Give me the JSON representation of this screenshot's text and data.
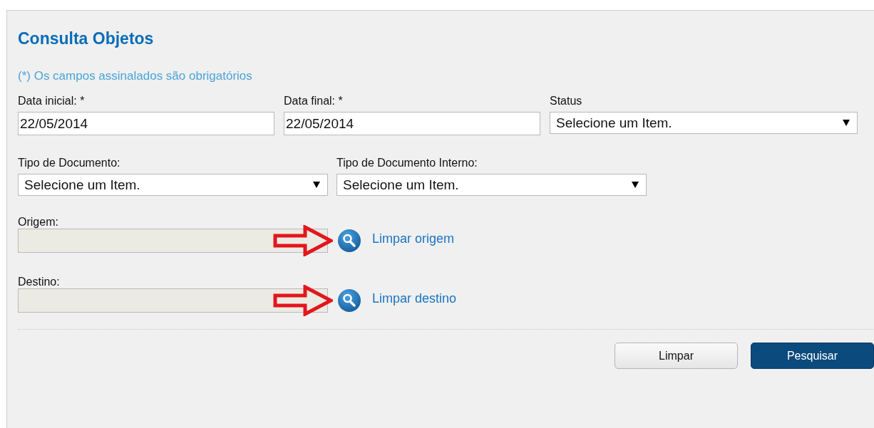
{
  "title": "Consulta Objetos",
  "required_note": "(*) Os campos assinalados são obrigatórios",
  "rows": [
    [
      {
        "kind": "text",
        "label": "Data inicial: *",
        "value": "22/05/2014"
      },
      {
        "kind": "text",
        "label": "Data final: *",
        "value": "22/05/2014"
      },
      {
        "kind": "select",
        "label": "Status",
        "value": "Selecione um Item."
      }
    ],
    [
      {
        "kind": "select",
        "label": "Tipo de Documento:",
        "value": "Selecione um Item."
      },
      {
        "kind": "select",
        "label": "Tipo de Documento Interno:",
        "value": "Selecione um Item."
      }
    ]
  ],
  "lookups": [
    {
      "label": "Origem:",
      "disabled": true,
      "link": "Limpar origem",
      "arrow": true
    },
    {
      "label": "Destino:",
      "disabled": true,
      "link": "Limpar destino",
      "arrow": true
    }
  ],
  "buttons": [
    {
      "label": "Limpar",
      "kind": "secondary"
    },
    {
      "label": "Pesquisar",
      "kind": "primary"
    }
  ]
}
